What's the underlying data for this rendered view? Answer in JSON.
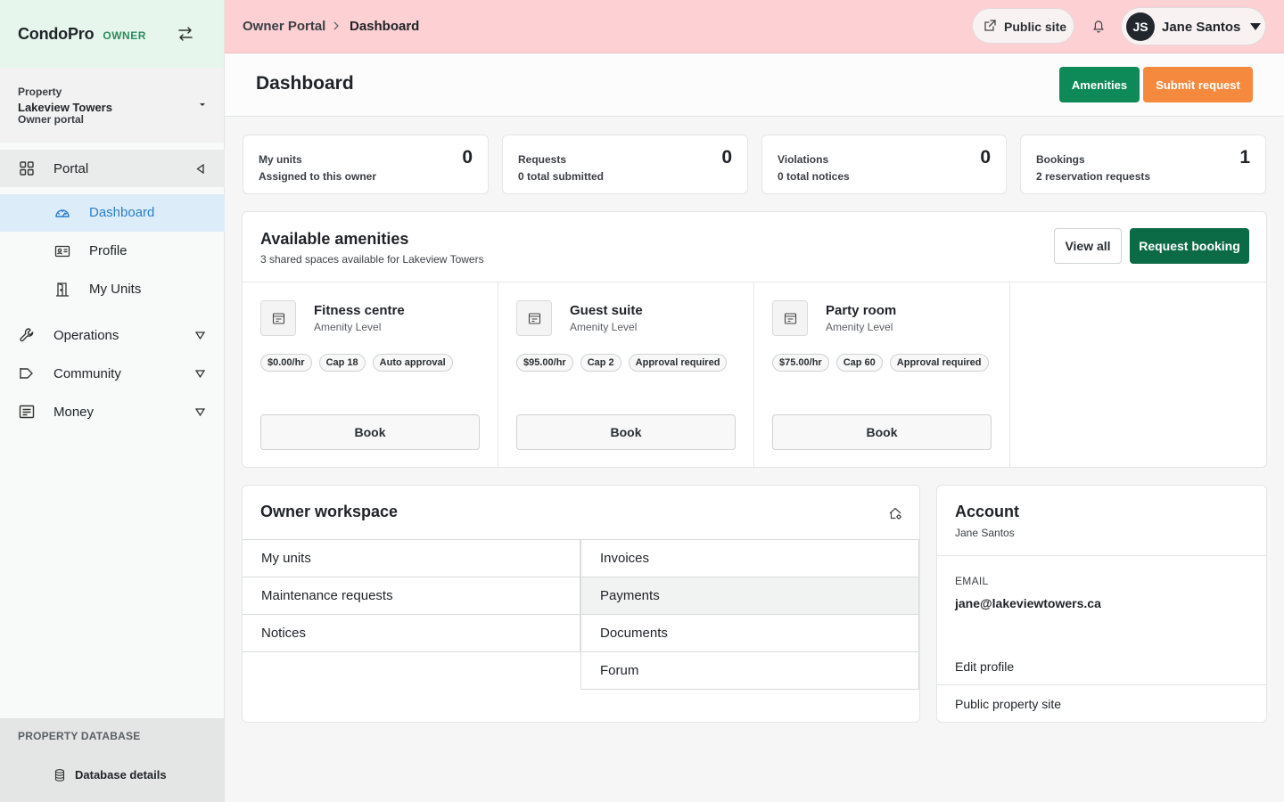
{
  "brand": {
    "name": "CondoPro",
    "tag": "OWNER"
  },
  "property": {
    "label": "Property",
    "name": "Lakeview Towers",
    "subtitle": "Owner portal"
  },
  "nav": {
    "portal": "Portal",
    "portal_items": [
      {
        "label": "Dashboard",
        "active": true
      },
      {
        "label": "Profile"
      },
      {
        "label": "My Units"
      }
    ],
    "operations": "Operations",
    "community": "Community",
    "money": "Money"
  },
  "database": {
    "title": "PROPERTY DATABASE",
    "link": "Database details"
  },
  "topbar": {
    "breadcrumb": [
      "Owner Portal",
      "Dashboard"
    ],
    "public_site": "Public site",
    "user_initials": "JS",
    "user_name": "Jane Santos"
  },
  "page": {
    "title": "Dashboard",
    "amenities_button": "Amenities",
    "submit_button": "Submit request"
  },
  "stats": [
    {
      "label": "My units",
      "sub": "Assigned to this owner",
      "value": "0"
    },
    {
      "label": "Requests",
      "sub": "0 total submitted",
      "value": "0"
    },
    {
      "label": "Violations",
      "sub": "0 total notices",
      "value": "0"
    },
    {
      "label": "Bookings",
      "sub": "2 reservation requests",
      "value": "1"
    }
  ],
  "amenities": {
    "title": "Available amenities",
    "subtitle": "3 shared spaces available for Lakeview Towers",
    "view_all": "View all",
    "request_booking": "Request booking",
    "items": [
      {
        "name": "Fitness centre",
        "level": "Amenity Level",
        "chips": [
          "$0.00/hr",
          "Cap 18",
          "Auto approval"
        ],
        "book": "Book"
      },
      {
        "name": "Guest suite",
        "level": "Amenity Level",
        "chips": [
          "$95.00/hr",
          "Cap 2",
          "Approval required"
        ],
        "book": "Book"
      },
      {
        "name": "Party room",
        "level": "Amenity Level",
        "chips": [
          "$75.00/hr",
          "Cap 60",
          "Approval required"
        ],
        "book": "Book"
      }
    ]
  },
  "workspace": {
    "title": "Owner workspace",
    "left": [
      "My units",
      "Maintenance requests",
      "Notices"
    ],
    "right": [
      "Invoices",
      "Payments",
      "Documents",
      "Forum"
    ]
  },
  "account": {
    "title": "Account",
    "name": "Jane Santos",
    "email_label": "EMAIL",
    "email": "jane@lakeviewtowers.ca",
    "edit_profile": "Edit profile",
    "public_site": "Public property site"
  },
  "colors": {
    "primary_green": "#0d8a57",
    "dark_green": "#0c6b47",
    "orange": "#f58a3e",
    "topbar_pink": "#fdd0d3",
    "active_blue": "#2a7fc8"
  }
}
